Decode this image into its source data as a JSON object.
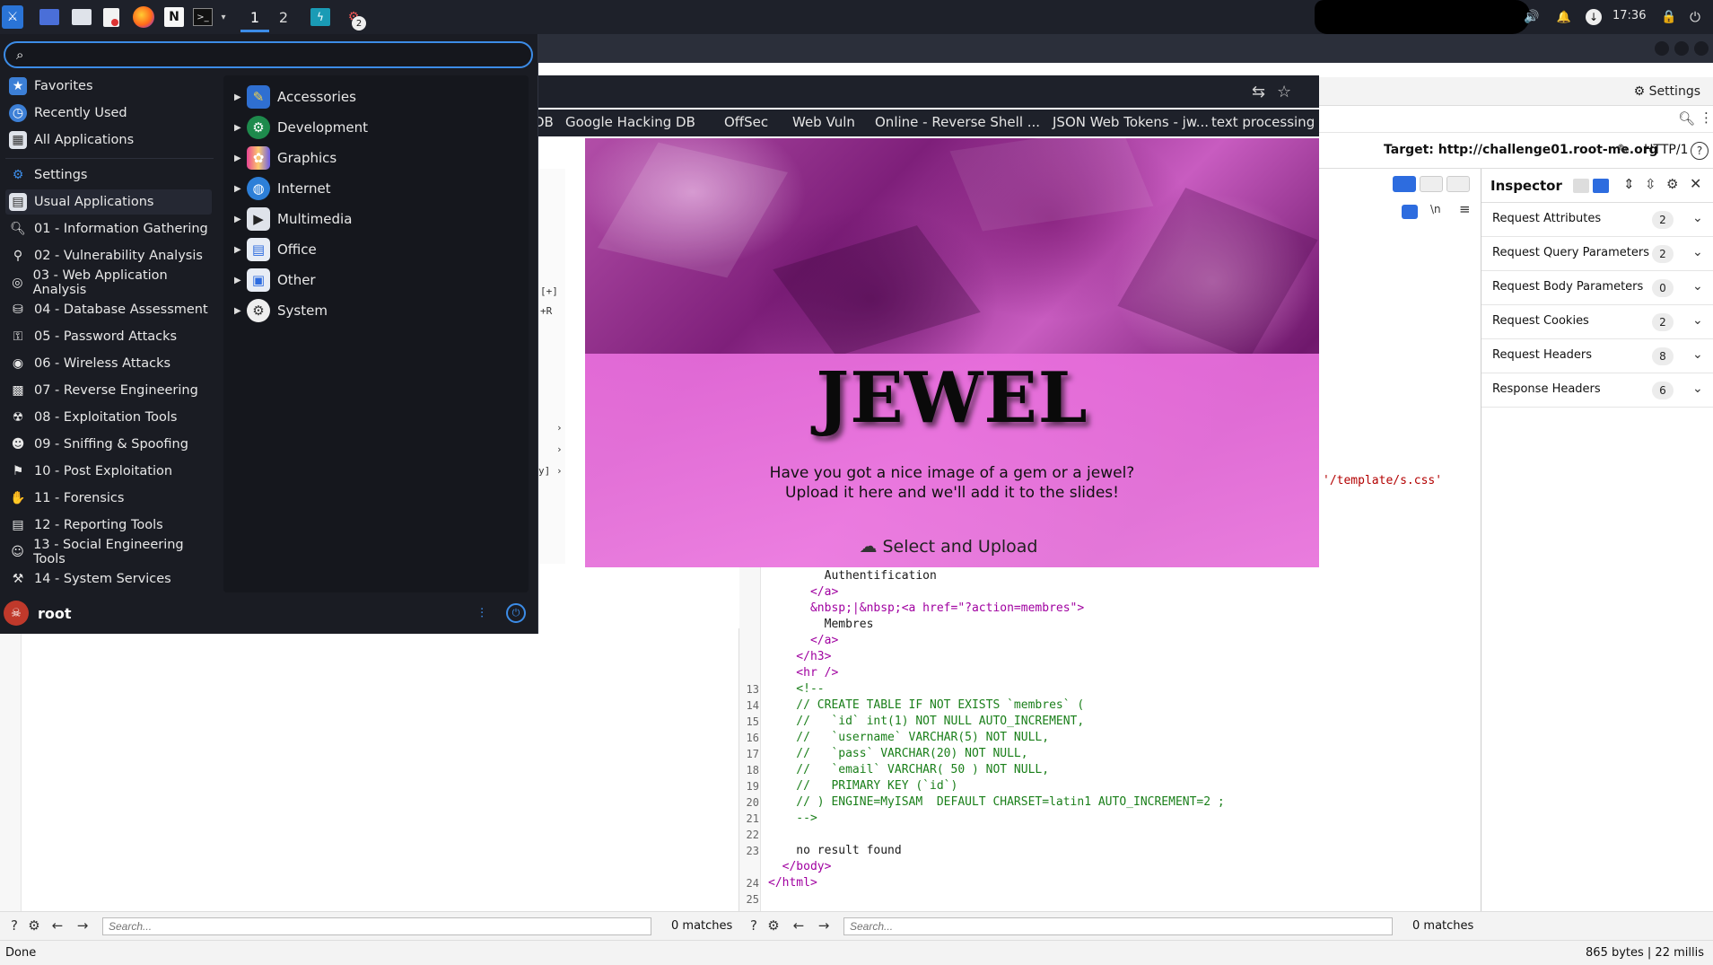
{
  "taskbar": {
    "workspaces": [
      "1",
      "2"
    ],
    "badge": "2",
    "clock": "17:36"
  },
  "browser": {
    "bookmarks": [
      "DB",
      "Google Hacking DB",
      "OffSec",
      "Web Vuln",
      "Online - Reverse Shell ...",
      "JSON Web Tokens - jw...",
      "text processing"
    ]
  },
  "jewel_page": {
    "title": "JEWEL",
    "line1": "Have you got a nice image of a gem or a jewel?",
    "line2": "Upload it here and we'll add it to the slides!",
    "upload_label": "Select and Upload"
  },
  "right_pane": {
    "settings_label": "Settings",
    "target": "Target: http://challenge01.root-me.org",
    "protocol": "HTTP/1",
    "css_ref": "'/template/s.css'"
  },
  "inspector": {
    "title": "Inspector",
    "rows": [
      {
        "label": "Request Attributes",
        "count": "2"
      },
      {
        "label": "Request Query Parameters",
        "count": "2"
      },
      {
        "label": "Request Body Parameters",
        "count": "0"
      },
      {
        "label": "Request Cookies",
        "count": "2"
      },
      {
        "label": "Request Headers",
        "count": "8"
      },
      {
        "label": "Response Headers",
        "count": "6"
      }
    ]
  },
  "code": {
    "lines": [
      {
        "n": "",
        "text": "        Authentification"
      },
      {
        "n": "",
        "text": "      </a>"
      },
      {
        "n": "",
        "text": "      &nbsp;|&nbsp;<a href=\"?action=membres\">"
      },
      {
        "n": "",
        "text": "        Membres"
      },
      {
        "n": "",
        "text": "      </a>"
      },
      {
        "n": "",
        "text": "    </h3>"
      },
      {
        "n": "",
        "text": "    <hr />"
      },
      {
        "n": "13",
        "text": "    <!--"
      },
      {
        "n": "14",
        "text": "    // CREATE TABLE IF NOT EXISTS `membres` ("
      },
      {
        "n": "15",
        "text": "    //   `id` int(1) NOT NULL AUTO_INCREMENT,"
      },
      {
        "n": "16",
        "text": "    //   `username` VARCHAR(5) NOT NULL,"
      },
      {
        "n": "17",
        "text": "    //   `pass` VARCHAR(20) NOT NULL,"
      },
      {
        "n": "18",
        "text": "    //   `email` VARCHAR( 50 ) NOT NULL,"
      },
      {
        "n": "19",
        "text": "    //   PRIMARY KEY (`id`)"
      },
      {
        "n": "20",
        "text": "    // ) ENGINE=MyISAM  DEFAULT CHARSET=latin1 AUTO_INCREMENT=2 ;"
      },
      {
        "n": "21",
        "text": "    -->"
      },
      {
        "n": "22",
        "text": ""
      },
      {
        "n": "23",
        "text": "    no result found"
      },
      {
        "n": "",
        "text": "  </body>"
      },
      {
        "n": "24",
        "text": "</html>"
      },
      {
        "n": "25",
        "text": ""
      }
    ],
    "left_fragments": [
      "[+]",
      "+R",
      "y]"
    ]
  },
  "bottom": {
    "left_search_placeholder": "Search...",
    "left_matches": "0 matches",
    "right_search_placeholder": "Search...",
    "right_matches": "0 matches",
    "status_left": "Done",
    "status_right": "865 bytes | 22 millis"
  },
  "menu": {
    "search_value": "",
    "categories": [
      {
        "label": "Favorites",
        "icon": "star-icon"
      },
      {
        "label": "Recently Used",
        "icon": "clock-icon"
      },
      {
        "label": "All Applications",
        "icon": "grid-icon"
      },
      {
        "label": "Settings",
        "icon": "gear-icon"
      },
      {
        "label": "Usual Applications",
        "icon": "folder-icon"
      },
      {
        "label": "01 - Information Gathering",
        "icon": "magnifier-icon"
      },
      {
        "label": "02 - Vulnerability Analysis",
        "icon": "bug-icon"
      },
      {
        "label": "03 - Web Application Analysis",
        "icon": "globe-icon"
      },
      {
        "label": "04 - Database Assessment",
        "icon": "database-icon"
      },
      {
        "label": "05 - Password Attacks",
        "icon": "key-icon"
      },
      {
        "label": "06 - Wireless Attacks",
        "icon": "wifi-icon"
      },
      {
        "label": "07 - Reverse Engineering",
        "icon": "chip-icon"
      },
      {
        "label": "08 - Exploitation Tools",
        "icon": "bomb-icon"
      },
      {
        "label": "09 - Sniffing & Spoofing",
        "icon": "mask-icon"
      },
      {
        "label": "10 - Post Exploitation",
        "icon": "door-icon"
      },
      {
        "label": "11 - Forensics",
        "icon": "hand-icon"
      },
      {
        "label": "12 - Reporting Tools",
        "icon": "report-icon"
      },
      {
        "label": "13 - Social Engineering Tools",
        "icon": "people-icon"
      },
      {
        "label": "14 - System Services",
        "icon": "service-icon"
      }
    ],
    "apps": [
      {
        "label": "Accessories",
        "icon": "accessories-icon"
      },
      {
        "label": "Development",
        "icon": "development-icon"
      },
      {
        "label": "Graphics",
        "icon": "graphics-icon"
      },
      {
        "label": "Internet",
        "icon": "internet-icon"
      },
      {
        "label": "Multimedia",
        "icon": "multimedia-icon"
      },
      {
        "label": "Office",
        "icon": "office-icon"
      },
      {
        "label": "Other",
        "icon": "other-icon"
      },
      {
        "label": "System",
        "icon": "system-icon"
      }
    ],
    "user": "root"
  }
}
